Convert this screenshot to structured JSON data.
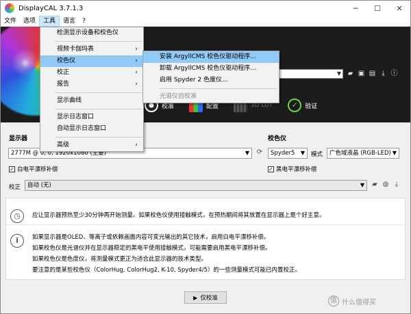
{
  "window": {
    "title": "DisplayCAL 3.7.1.3",
    "min": "─",
    "max": "☐",
    "close": "✕"
  },
  "menubar": [
    "文件",
    "选项",
    "工具",
    "语言",
    "?"
  ],
  "tools_menu": [
    {
      "label": "检测显示设备和校色仪"
    },
    {
      "label": "视频卡伽玛表",
      "submenu": true
    },
    {
      "label": "校色仪",
      "submenu": true,
      "highlighted": true
    },
    {
      "label": "校正",
      "submenu": true
    },
    {
      "label": "报告",
      "submenu": true
    },
    {
      "label": "显示曲线"
    },
    {
      "label": "显示日志窗口"
    },
    {
      "label": "自动显示日志窗口"
    },
    {
      "label": "高级",
      "submenu": true
    }
  ],
  "instrument_submenu": [
    {
      "label": "安装 ArgyllCMS 校色仪驱动程序...",
      "highlighted": true
    },
    {
      "label": "卸载 ArgyllCMS 校色仪驱动程序..."
    },
    {
      "label": "启用 Spyder 2 色度仪..."
    },
    {
      "label": "光谱仪自校准",
      "disabled": true
    }
  ],
  "tabs": [
    {
      "label": "校准",
      "icon": "calibrate-icon"
    },
    {
      "label": "配置",
      "icon": "profile-icon"
    },
    {
      "label": "3D LUT",
      "icon": "lut3d-icon",
      "disabled": true
    },
    {
      "label": "验证",
      "icon": "verify-icon"
    }
  ],
  "display": {
    "label": "显示器",
    "value": "2777M @ 0, 0, 1920x1080 (主要)",
    "white_drift": "白电平漂移补偿",
    "white_drift_checked": true
  },
  "instrument": {
    "label": "校色仪",
    "value": "Spyder5",
    "mode_label": "模式",
    "mode_value": "广色域液晶 (RGB-LED)",
    "black_drift": "黑电平漂移补偿",
    "black_drift_checked": true
  },
  "correction": {
    "label": "校正",
    "value": "自动 (无)"
  },
  "info": {
    "line1": "应让显示器预热至少30分钟再开始测量。如果校色仪使用接触模式，在预热期间将其放置在显示器上是个好主意。",
    "lines": [
      "如果显示器是OLED、等离子或依赖画面内容可变光输出的其它技术，启用白电平漂移补偿。",
      "如果校色仪是光谱仪并在显示器稳定的黑电平使用接触模式，可能需要启用黑电平漂移补偿。",
      "如果校色仪是色度仪，将测量模式更正为适合此显示器的技术类型。",
      "要注意的是某些校色仪（ColorHug, ColorHug2, K-10, Spyder4/5）的一些测量模式可能已内置校正。"
    ]
  },
  "calibrate_button": "仅校准",
  "watermark": "什么值得买",
  "colors": {
    "banner": "#1c1c1c",
    "menu_highlight": "#91c9f7",
    "accent_green": "#6cd34c"
  }
}
